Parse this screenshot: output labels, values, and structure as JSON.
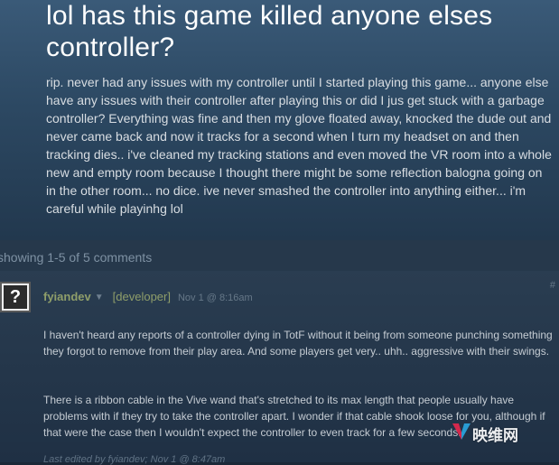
{
  "topic": {
    "title": "lol has this game killed anyone elses controller?",
    "body": "rip. never had any issues with my controller until I started playing this game... anyone else have any issues with their controller after playing this or did I jus get stuck with a garbage controller? Everything was fine and then my glove floated away, knocked the dude out and never came back and now it tracks for a second when I turn my headset on and then tracking dies.. i've cleaned my tracking stations and even moved the VR room into a whole new and empty room because I thought there might be some reflection balogna going on in the other room... no dice. ive never smashed the controller into anything either... i'm careful while playinhg lol"
  },
  "comments_header": {
    "count_text": "showing 1-5 of 5 comments"
  },
  "comment": {
    "avatar_glyph": "?",
    "author": "fyiandev",
    "caret": "▼",
    "role": "[developer]",
    "date": "Nov 1 @ 8:16am",
    "number": "#",
    "paragraph1": "I haven't heard any reports of a controller dying in TotF without it being from someone punching something they forgot to remove from their play area. And some players get very.. uhh.. aggressive with their swings.",
    "paragraph2": "There is a ribbon cable in the Vive wand that's stretched to its max length that people usually have problems with if they try to take the controller apart. I wonder if that cable shook loose for you, although if that were the case then I wouldn't expect the controller to even track for a few seconds.",
    "edited": "Last edited by fyiandev; Nov 1 @ 8:47am"
  },
  "watermark": {
    "text": "映维网",
    "icon": "v-logo-icon"
  },
  "colors": {
    "accent_developer": "#8f9e6a",
    "watermark_v_left": "#e4284d",
    "watermark_v_right": "#2aa6e0"
  }
}
